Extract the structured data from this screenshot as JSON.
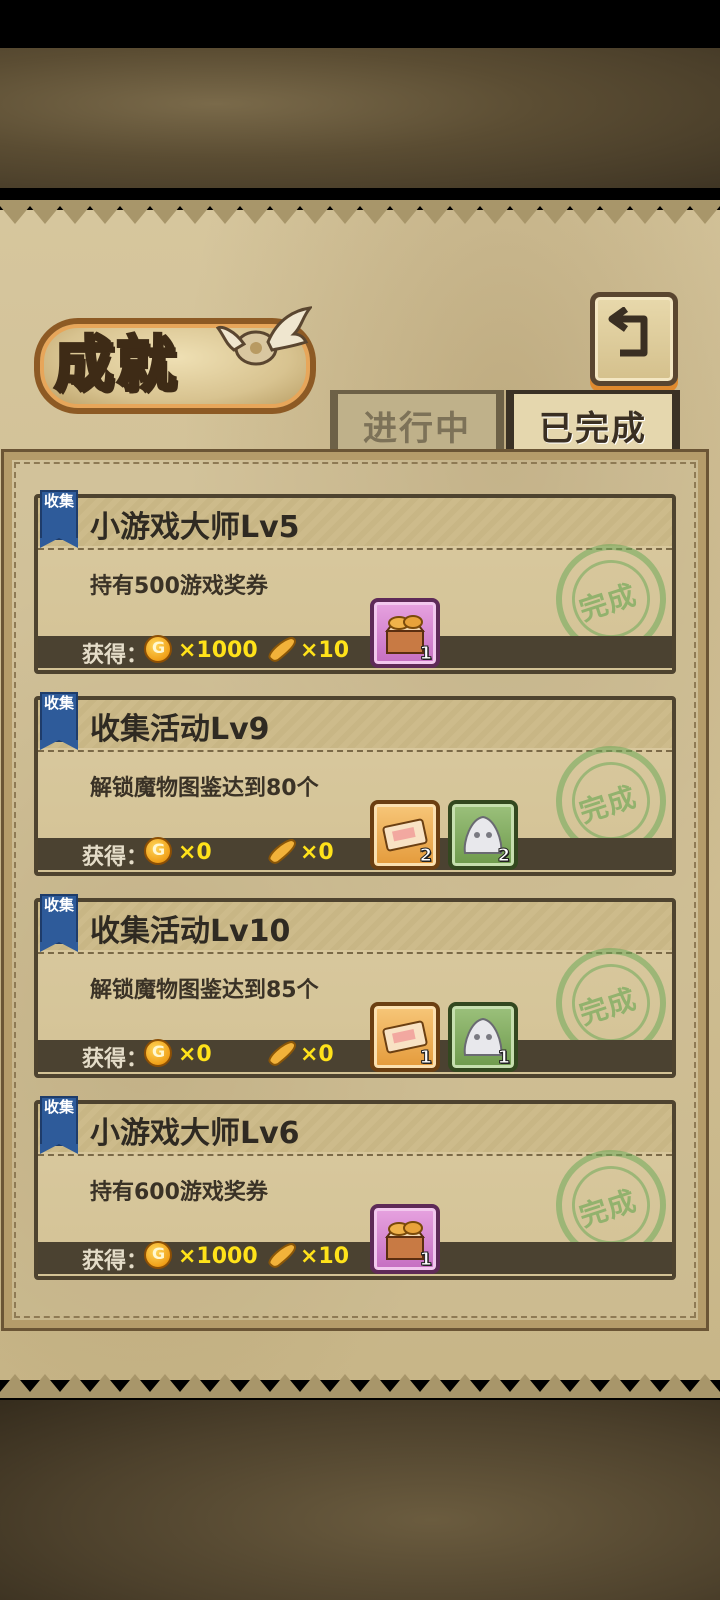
{
  "header": {
    "title": "成就",
    "back_icon": "back-arrow-icon"
  },
  "tabs": [
    {
      "label": "进行中",
      "active": false
    },
    {
      "label": "已完成",
      "active": true
    }
  ],
  "reward_label": "获得：",
  "coin_icon_letter": "G",
  "stamp_text": "完成",
  "achievements": [
    {
      "badge": "收集",
      "title": "小游戏大师Lv5",
      "description": "持有500游戏奖券",
      "coins": "×1000",
      "bread": "×10",
      "items": [
        {
          "icon": "bread-basket-icon",
          "count": "1",
          "frame": "pink"
        }
      ]
    },
    {
      "badge": "收集",
      "title": "收集活动Lv9",
      "description": "解锁魔物图鉴达到80个",
      "coins": "×0",
      "bread": "×0",
      "items": [
        {
          "icon": "ticket-icon",
          "count": "2",
          "frame": "orange"
        },
        {
          "icon": "slime-icon",
          "count": "2",
          "frame": "green"
        }
      ]
    },
    {
      "badge": "收集",
      "title": "收集活动Lv10",
      "description": "解锁魔物图鉴达到85个",
      "coins": "×0",
      "bread": "×0",
      "items": [
        {
          "icon": "ticket-icon",
          "count": "1",
          "frame": "orange"
        },
        {
          "icon": "slime-icon",
          "count": "1",
          "frame": "green"
        }
      ]
    },
    {
      "badge": "收集",
      "title": "小游戏大师Lv6",
      "description": "持有600游戏奖券",
      "coins": "×1000",
      "bread": "×10",
      "items": [
        {
          "icon": "bread-basket-icon",
          "count": "1",
          "frame": "pink"
        }
      ]
    }
  ]
}
